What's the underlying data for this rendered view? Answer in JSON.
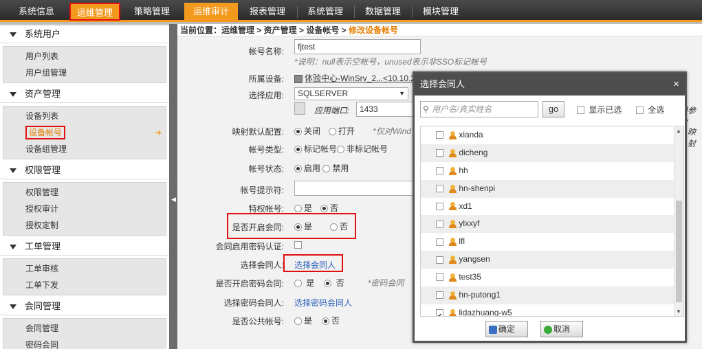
{
  "nav": {
    "tabs": [
      "系统信息",
      "运维管理",
      "策略管理",
      "运维审计",
      "报表管理",
      "系统管理",
      "数据管理",
      "模块管理"
    ]
  },
  "sidebar": {
    "sections": [
      {
        "title": "系统用户",
        "items": [
          "用户列表",
          "用户组管理"
        ]
      },
      {
        "title": "资产管理",
        "items": [
          "设备列表",
          "设备帐号",
          "设备组管理"
        ]
      },
      {
        "title": "权限管理",
        "items": [
          "权限管理",
          "授权审计",
          "授权定制"
        ]
      },
      {
        "title": "工单管理",
        "items": [
          "工单审核",
          "工单下发"
        ]
      },
      {
        "title": "会同管理",
        "items": [
          "会同管理",
          "密码会同"
        ]
      }
    ]
  },
  "breadcrumb": {
    "prefix": "当前位置：运维管理 > 资产管理 > 设备帐号 > ",
    "current": "修改设备帐号"
  },
  "form": {
    "account_name_label": "帐号名称:",
    "account_name_value": "fjtest",
    "account_name_hint": "*说明：null表示空帐号，unused表示非SSO标记帐号",
    "device_label": "所属设备:",
    "device_value": "体验中心-WinSrv_2...<10.10.200.190>",
    "app_label": "选择应用:",
    "app_value": "SQLSERVER",
    "port_label": "应用端口:",
    "port_value": "1433",
    "port_extra": "用参数",
    "map_label": "映射默认配置:",
    "map_off": "关闭",
    "map_on": "打开",
    "map_hint": "*仅对Wind",
    "map_extra": "映射",
    "type_label": "帐号类型:",
    "type_tagged": "标记帐号",
    "type_untagged": "非标记帐号",
    "status_label": "帐号状态:",
    "status_enabled": "启用",
    "status_disabled": "禁用",
    "prompt_label": "帐号提示符:",
    "priv_label": "特权帐号:",
    "yes": "是",
    "no": "否",
    "cosign_label": "是否开启会同:",
    "cosign_pwd_auth_label": "会同启用密码认证:",
    "select_cosigner_label": "选择会同人:",
    "select_cosigner_link": "选择会同人",
    "pwd_cosign_label": "是否开启密码会同:",
    "pwd_cosign_hint": "*密码会同",
    "select_pwd_cosigner_label": "选择密码会同人:",
    "select_pwd_cosigner_link": "选择密码会同人",
    "public_label": "是否公共帐号:"
  },
  "modal": {
    "title": "选择会同人",
    "close": "×",
    "search_placeholder": "用户名/真实姓名",
    "go": "go",
    "show_selected": "显示已选",
    "select_all": "全选",
    "users": [
      {
        "name": "xianda",
        "checked": false
      },
      {
        "name": "dicheng",
        "checked": false
      },
      {
        "name": "hh",
        "checked": false
      },
      {
        "name": "hn-shenpi",
        "checked": false
      },
      {
        "name": "xd1",
        "checked": false
      },
      {
        "name": "ylxxyf",
        "checked": false
      },
      {
        "name": "lfl",
        "checked": false
      },
      {
        "name": "yangsen",
        "checked": false
      },
      {
        "name": "test35",
        "checked": false
      },
      {
        "name": "hn-putong1",
        "checked": false
      },
      {
        "name": "lidazhuang-w5",
        "checked": true
      }
    ],
    "ok": "确定",
    "cancel": "取消"
  },
  "colors": {
    "accent": "#f39a1e",
    "highlight_border": "#e01010",
    "link": "#2b5fb8"
  }
}
